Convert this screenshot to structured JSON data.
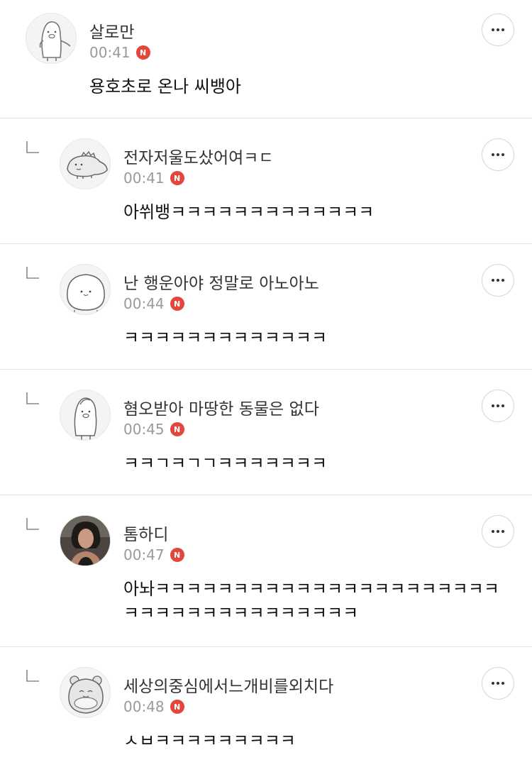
{
  "comments": [
    {
      "author": "살로만",
      "time": "00:41",
      "badge": "N",
      "text": "용호초로 온나 씨뱅아",
      "avatar_icon": "penguin-character-icon"
    },
    {
      "author": "전자저울도샀어여ㅋㄷ",
      "time": "00:41",
      "badge": "N",
      "text": "아쒸뱅ㅋㅋㅋㅋㅋㅋㅋㅋㅋㅋㅋㅋㅋ",
      "avatar_icon": "dinosaur-character-icon"
    },
    {
      "author": "난 행운아야 정말로 아노아노",
      "time": "00:44",
      "badge": "N",
      "text": "ㅋㅋㅋㅋㅋㅋㅋㅋㅋㅋㅋㅋㅋ",
      "avatar_icon": "round-character-icon"
    },
    {
      "author": "혐오받아 마땅한 동물은 없다",
      "time": "00:45",
      "badge": "N",
      "text": "ㅋㅋㄱㅋㄱㄱㅋㅋㅋㅋㅋㅋㅋ",
      "avatar_icon": "penguin-character-icon"
    },
    {
      "author": "톰하디",
      "time": "00:47",
      "badge": "N",
      "text": "아놔ㅋㅋㅋㅋㅋㅋㅋㅋㅋㅋㅋㅋㅋㅋㅋㅋㅋㅋㅋㅋㅋㅋㅋㅋㅋㅋㅋㅋㅋㅋㅋㅋㅋㅋㅋㅋㅋ",
      "avatar_icon": "photo-avatar"
    },
    {
      "author": "세상의중심에서느개비를외치다",
      "time": "00:48",
      "badge": "N",
      "text": "ㅅㅂㅋㅋㅋㅋㅋㅋㅋㅋㅋ",
      "avatar_icon": "hamster-character-icon"
    }
  ],
  "colors": {
    "badge": "#e3463b",
    "time": "#9a9a9a",
    "divider": "#e3e3e3"
  }
}
